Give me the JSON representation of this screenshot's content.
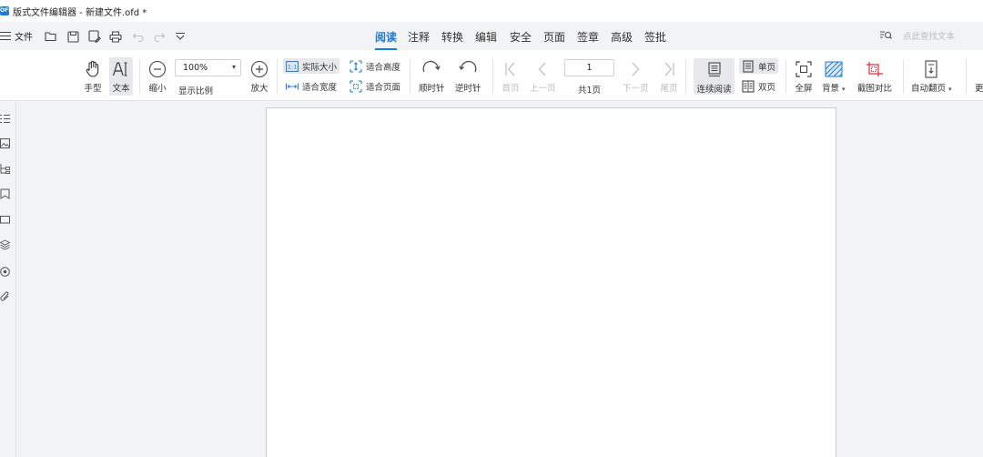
{
  "titlebar": {
    "logo_text": "OFD",
    "title": "版式文件编辑器 - 新建文件.ofd *"
  },
  "menubar": {
    "file_label": "文件",
    "quick_access_icons": [
      "open-icon",
      "save-icon",
      "save-as-icon",
      "print-icon",
      "undo-icon",
      "redo-icon",
      "customize-icon"
    ],
    "tabs": [
      {
        "label": "阅读",
        "active": true
      },
      {
        "label": "注释",
        "active": false
      },
      {
        "label": "转换",
        "active": false
      },
      {
        "label": "编辑",
        "active": false
      },
      {
        "label": "安全",
        "active": false
      },
      {
        "label": "页面",
        "active": false
      },
      {
        "label": "签章",
        "active": false
      },
      {
        "label": "高级",
        "active": false
      },
      {
        "label": "签批",
        "active": false
      }
    ],
    "search_placeholder": "点此查找文本"
  },
  "ribbon": {
    "hand_tool": "手型",
    "text_tool": "文本",
    "zoom_out": "缩小",
    "zoom_value": "100%",
    "zoom_label": "显示比例",
    "zoom_in": "放大",
    "actual_size": "实际大小",
    "fit_width": "适合宽度",
    "fit_height": "适合高度",
    "fit_page": "适合页面",
    "rotate_cw": "顺时针",
    "rotate_ccw": "逆时针",
    "first_page": "首页",
    "prev_page": "上一页",
    "page_number": "1",
    "page_total": "共1页",
    "next_page": "下一页",
    "last_page": "尾页",
    "continuous": "连续阅读",
    "single_page": "单页",
    "double_page": "双页",
    "fullscreen": "全屏",
    "background": "背景",
    "screenshot_compare": "截图对比",
    "auto_flip": "自动翻页",
    "more": "更"
  },
  "sidebar": {
    "icons": [
      "outline-icon",
      "thumbnail-icon",
      "structure-icon",
      "bookmark-icon",
      "annotation-icon",
      "layers-icon",
      "seal-icon",
      "attachment-icon"
    ]
  },
  "colors": {
    "accent": "#1a7bd8",
    "screenshot_compare": "#d9303a",
    "background": "#f2f3f5"
  }
}
